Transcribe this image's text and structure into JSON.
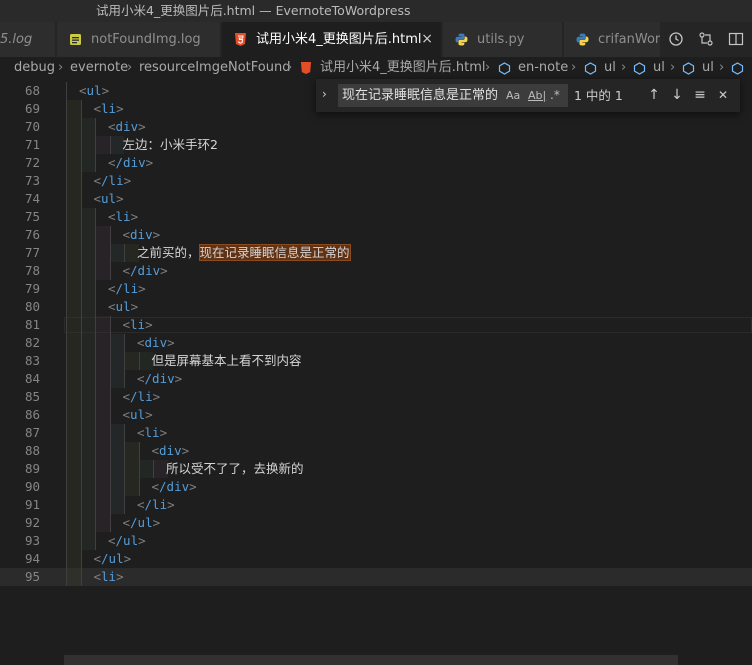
{
  "window": {
    "title": "试用小米4_更换图片后.html — EvernoteToWordpress"
  },
  "tabs": [
    {
      "label": "5.log",
      "icon": "log-file-icon",
      "active": false
    },
    {
      "label": "notFoundImg.log",
      "icon": "log-file-icon",
      "active": false
    },
    {
      "label": "试用小米4_更换图片后.html",
      "icon": "html5-icon",
      "active": true,
      "close": "×"
    },
    {
      "label": "utils.py",
      "icon": "python-icon",
      "active": false
    },
    {
      "label": "crifanWord",
      "icon": "python-icon",
      "active": false
    }
  ],
  "toolbar_icons": [
    "history-icon",
    "compare-changes-icon",
    "split-editor-icon"
  ],
  "breadcrumb": {
    "items": [
      "debug",
      "evernote",
      "resourceImgeNotFound",
      "试用小米4_更换图片后.html",
      "en-note",
      "ul",
      "ul",
      "ul"
    ]
  },
  "find": {
    "query": "现在记录睡眠信息是正常的",
    "match_case": "Aa",
    "whole_word": "Ab|",
    "regex": ".*",
    "result": "1 中的 1",
    "prev_icon": "↑",
    "next_icon": "↓",
    "in_selection_icon": "≡",
    "close_icon": "✕"
  },
  "lines": [
    {
      "n": "68",
      "indent": 1,
      "tag": "ul"
    },
    {
      "n": "69",
      "indent": 2,
      "tag": "li"
    },
    {
      "n": "70",
      "indent": 3,
      "tag": "div"
    },
    {
      "n": "71",
      "indent": 4,
      "text": "左边：小米手环2"
    },
    {
      "n": "72",
      "indent": 3,
      "tag": "/div"
    },
    {
      "n": "73",
      "indent": 2,
      "tag": "/li"
    },
    {
      "n": "74",
      "indent": 2,
      "tag": "ul"
    },
    {
      "n": "75",
      "indent": 3,
      "tag": "li"
    },
    {
      "n": "76",
      "indent": 4,
      "tag": "div"
    },
    {
      "n": "77",
      "indent": 5,
      "text": "之前买的，",
      "highlight": "现在记录睡眠信息是正常的"
    },
    {
      "n": "78",
      "indent": 4,
      "tag": "/div"
    },
    {
      "n": "79",
      "indent": 3,
      "tag": "/li"
    },
    {
      "n": "80",
      "indent": 3,
      "tag": "ul"
    },
    {
      "n": "81",
      "indent": 4,
      "tag": "li"
    },
    {
      "n": "82",
      "indent": 5,
      "tag": "div"
    },
    {
      "n": "83",
      "indent": 6,
      "text": "但是屏幕基本上看不到内容"
    },
    {
      "n": "84",
      "indent": 5,
      "tag": "/div"
    },
    {
      "n": "85",
      "indent": 4,
      "tag": "/li"
    },
    {
      "n": "86",
      "indent": 4,
      "tag": "ul"
    },
    {
      "n": "87",
      "indent": 5,
      "tag": "li"
    },
    {
      "n": "88",
      "indent": 6,
      "tag": "div"
    },
    {
      "n": "89",
      "indent": 7,
      "text": "所以受不了了，去换新的"
    },
    {
      "n": "90",
      "indent": 6,
      "tag": "/div"
    },
    {
      "n": "91",
      "indent": 5,
      "tag": "/li"
    },
    {
      "n": "92",
      "indent": 4,
      "tag": "/ul"
    },
    {
      "n": "93",
      "indent": 3,
      "tag": "/ul"
    },
    {
      "n": "94",
      "indent": 2,
      "tag": "/ul"
    },
    {
      "n": "95",
      "indent": 2,
      "tag": "li"
    }
  ],
  "colors": {
    "tag": "#569cd6",
    "bracket": "#808080",
    "find_highlight": "#613214"
  }
}
